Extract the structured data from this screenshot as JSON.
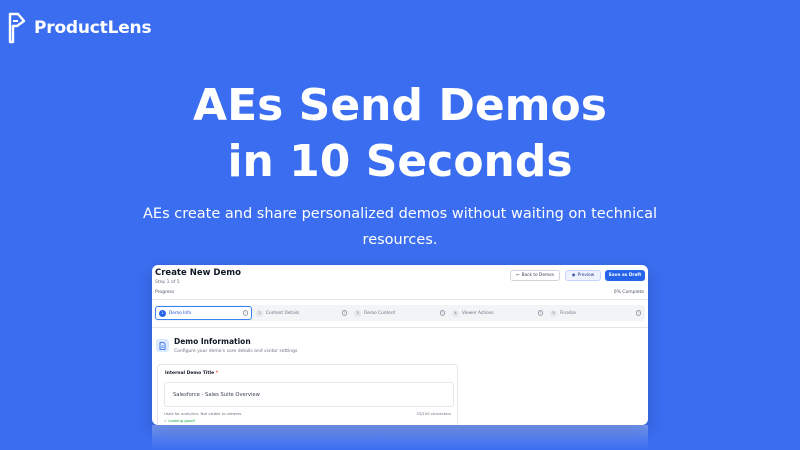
{
  "brand": {
    "name": "ProductLens",
    "icon": "productlens-logo-icon"
  },
  "hero": {
    "title_line1": "AEs Send Demos",
    "title_line2": "in 10 Seconds",
    "subtitle": "AEs create and share personalized demos without waiting on technical resources."
  },
  "app": {
    "title": "Create New Demo",
    "step_indicator": "Step 1 of 5",
    "buttons": {
      "back": "Back to Demos",
      "preview": "Preview",
      "save_draft": "Save as Draft"
    },
    "progress": {
      "label": "Progress",
      "percent_text": "0% Complete"
    },
    "steps": [
      {
        "num": "1",
        "label": "Demo Info",
        "active": true
      },
      {
        "num": "2",
        "label": "Content Details",
        "active": false
      },
      {
        "num": "3",
        "label": "Demo Content",
        "active": false
      },
      {
        "num": "4",
        "label": "Viewer Actions",
        "active": false
      },
      {
        "num": "5",
        "label": "Finalize",
        "active": false
      }
    ],
    "section": {
      "icon": "document-icon",
      "title": "Demo Information",
      "subtitle": "Configure your demo's core details and visitor settings"
    },
    "field": {
      "label": "Internal Demo Title",
      "required_mark": "*",
      "value": "Salesforce - Sales Suite Overview",
      "help": "Used for analytics. Not visible to viewers",
      "count": "33/100 characters",
      "status": "✓ Looking good!"
    }
  },
  "colors": {
    "background": "#3a6df0",
    "accent": "#2563eb",
    "success": "#16a34a"
  }
}
